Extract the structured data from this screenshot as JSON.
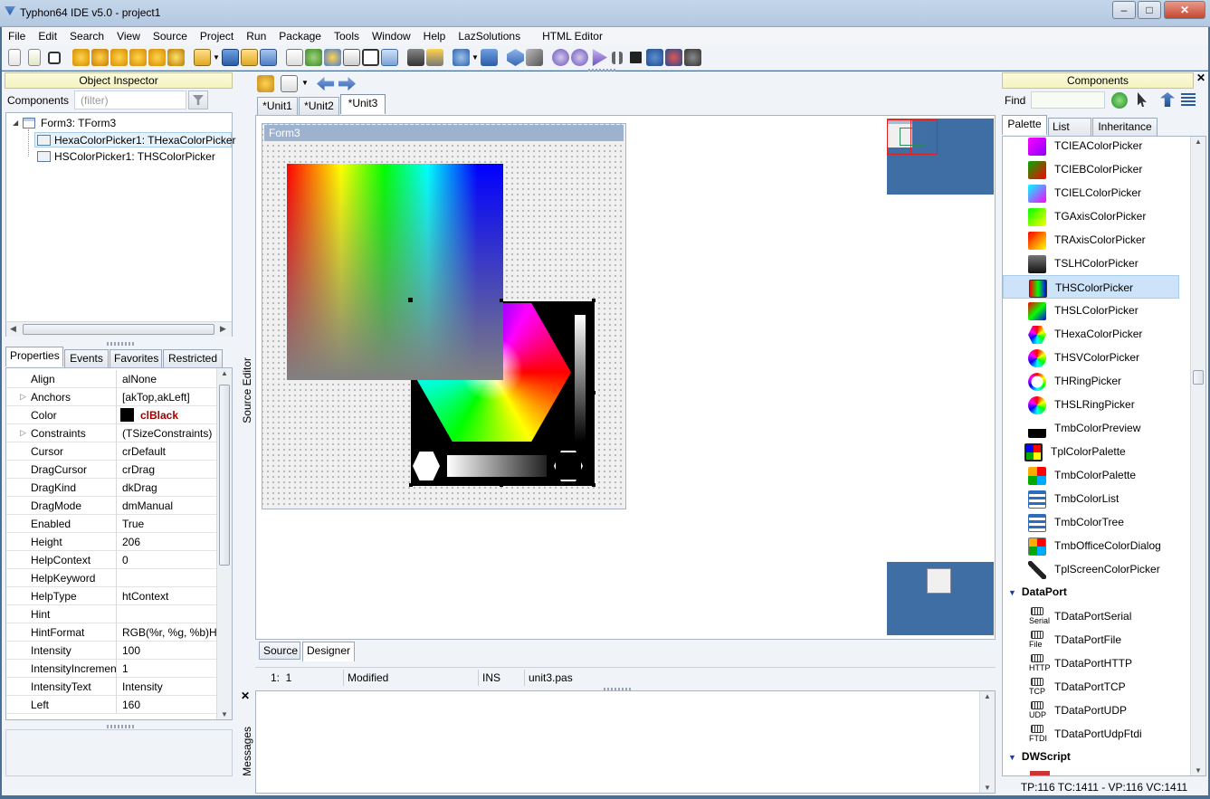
{
  "window": {
    "title": "Typhon64 IDE v5.0 - project1"
  },
  "menu": [
    "File",
    "Edit",
    "Search",
    "View",
    "Source",
    "Project",
    "Run",
    "Package",
    "Tools",
    "Window",
    "Help",
    "LazSolutions",
    "HTML Editor"
  ],
  "object_inspector": {
    "title": "Object Inspector",
    "components_label": "Components",
    "filter_placeholder": "(filter)",
    "tree": [
      {
        "label": "Form3: TForm3"
      },
      {
        "label": "HexaColorPicker1: THexaColorPicker"
      },
      {
        "label": "HSColorPicker1: THSColorPicker"
      }
    ],
    "tabs": [
      "Properties",
      "Events",
      "Favorites",
      "Restricted"
    ],
    "properties": [
      {
        "name": "Align",
        "value": "alNone"
      },
      {
        "name": "Anchors",
        "value": "[akTop,akLeft]"
      },
      {
        "name": "Color",
        "value": "clBlack"
      },
      {
        "name": "Constraints",
        "value": "(TSizeConstraints)"
      },
      {
        "name": "Cursor",
        "value": "crDefault"
      },
      {
        "name": "DragCursor",
        "value": "crDrag"
      },
      {
        "name": "DragKind",
        "value": "dkDrag"
      },
      {
        "name": "DragMode",
        "value": "dmManual"
      },
      {
        "name": "Enabled",
        "value": "True"
      },
      {
        "name": "Height",
        "value": "206"
      },
      {
        "name": "HelpContext",
        "value": "0"
      },
      {
        "name": "HelpKeyword",
        "value": ""
      },
      {
        "name": "HelpType",
        "value": "htContext"
      },
      {
        "name": "Hint",
        "value": ""
      },
      {
        "name": "HintFormat",
        "value": "RGB(%r, %g, %b)Hex"
      },
      {
        "name": "Intensity",
        "value": "100"
      },
      {
        "name": "IntensityIncrement",
        "value": "1"
      },
      {
        "name": "IntensityText",
        "value": "Intensity"
      },
      {
        "name": "Left",
        "value": "160"
      }
    ]
  },
  "editor": {
    "source_editor_label": "Source Editor",
    "tabs": [
      "*Unit1",
      "*Unit2",
      "*Unit3"
    ],
    "form_caption": "Form3",
    "bottom_tabs": [
      "Source",
      "Designer"
    ],
    "status": {
      "position": "1:  1",
      "modified": "Modified",
      "mode": "INS",
      "file": "unit3.pas"
    }
  },
  "messages": {
    "label": "Messages"
  },
  "components_panel": {
    "title": "Components",
    "find_label": "Find",
    "tabs": [
      "Palette",
      "List",
      "Inheritance"
    ],
    "items": [
      {
        "label": "TCIEAColorPicker",
        "icon": "cie-a-picker-icon"
      },
      {
        "label": "TCIEBColorPicker",
        "icon": "cie-b-picker-icon"
      },
      {
        "label": "TCIELColorPicker",
        "icon": "cie-l-picker-icon"
      },
      {
        "label": "TGAxisColorPicker",
        "icon": "g-axis-picker-icon"
      },
      {
        "label": "TRAxisColorPicker",
        "icon": "r-axis-picker-icon"
      },
      {
        "label": "TSLHColorPicker",
        "icon": "slh-picker-icon"
      },
      {
        "label": "THSColorPicker",
        "icon": "hs-picker-icon",
        "selected": true
      },
      {
        "label": "THSLColorPicker",
        "icon": "hsl-picker-icon"
      },
      {
        "label": "THexaColorPicker",
        "icon": "hexa-picker-icon"
      },
      {
        "label": "THSVColorPicker",
        "icon": "hsv-picker-icon"
      },
      {
        "label": "THRingPicker",
        "icon": "h-ring-picker-icon"
      },
      {
        "label": "THSLRingPicker",
        "icon": "hsl-ring-picker-icon"
      },
      {
        "label": "TmbColorPreview",
        "icon": "color-preview-icon"
      },
      {
        "label": "TplColorPalette",
        "icon": "color-palette-icon"
      },
      {
        "label": "TmbColorPalette",
        "icon": "mb-color-palette-icon"
      },
      {
        "label": "TmbColorList",
        "icon": "color-list-icon"
      },
      {
        "label": "TmbColorTree",
        "icon": "color-tree-icon"
      },
      {
        "label": "TmbOfficeColorDialog",
        "icon": "office-color-dialog-icon"
      },
      {
        "label": "TplScreenColorPicker",
        "icon": "eyedropper-icon"
      }
    ],
    "categories": [
      {
        "label": "DataPort",
        "items": [
          {
            "label": "TDataPortSerial",
            "sub": "Serial"
          },
          {
            "label": "TDataPortFile",
            "sub": "File"
          },
          {
            "label": "TDataPortHTTP",
            "sub": "HTTP"
          },
          {
            "label": "TDataPortTCP",
            "sub": "TCP"
          },
          {
            "label": "TDataPortUDP",
            "sub": "UDP"
          },
          {
            "label": "TDataPortUdpFtdi",
            "sub": "FTDI"
          }
        ]
      },
      {
        "label": "DWScript",
        "items": []
      }
    ],
    "status": "TP:116 TC:1411 - VP:116 VC:1411"
  },
  "colors": {
    "accent": "#cfe3f8",
    "selection": "#cde3f9",
    "desktop": "#3f6ea4"
  }
}
